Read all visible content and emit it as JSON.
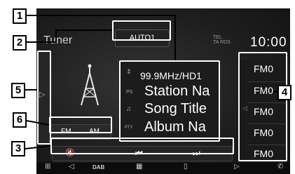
{
  "screen": {
    "source_label": "Tuner",
    "auto_button": "AUTO1",
    "status_small": [
      "TEL",
      "TA RDS"
    ],
    "clock": "10:00",
    "left_handle_chevron": "▷",
    "info": {
      "arrow": "⇕",
      "frequency": "99.9MHz/HD1",
      "ps_tag": "PS",
      "station": "Station Na",
      "song_tag": "♫",
      "song": "Song Title",
      "pty_tag": "PTY",
      "album": "Album Na"
    },
    "band_buttons": [
      "FM",
      "AM"
    ],
    "controls": {
      "mute": "🔇",
      "prev": "⏮",
      "next": "⏭"
    },
    "presets_chevron": "◁",
    "presets": [
      "FM0",
      "FM0",
      "FM0",
      "FM0",
      "FM0"
    ],
    "bottom_bar": {
      "apps": "⊞",
      "back": "◁",
      "dab": "DAB",
      "grid": "▦",
      "phone_mirror": "▯",
      "forward": "▷",
      "phone": "✆"
    }
  },
  "callouts": [
    "1",
    "2",
    "3",
    "4",
    "5",
    "6"
  ]
}
